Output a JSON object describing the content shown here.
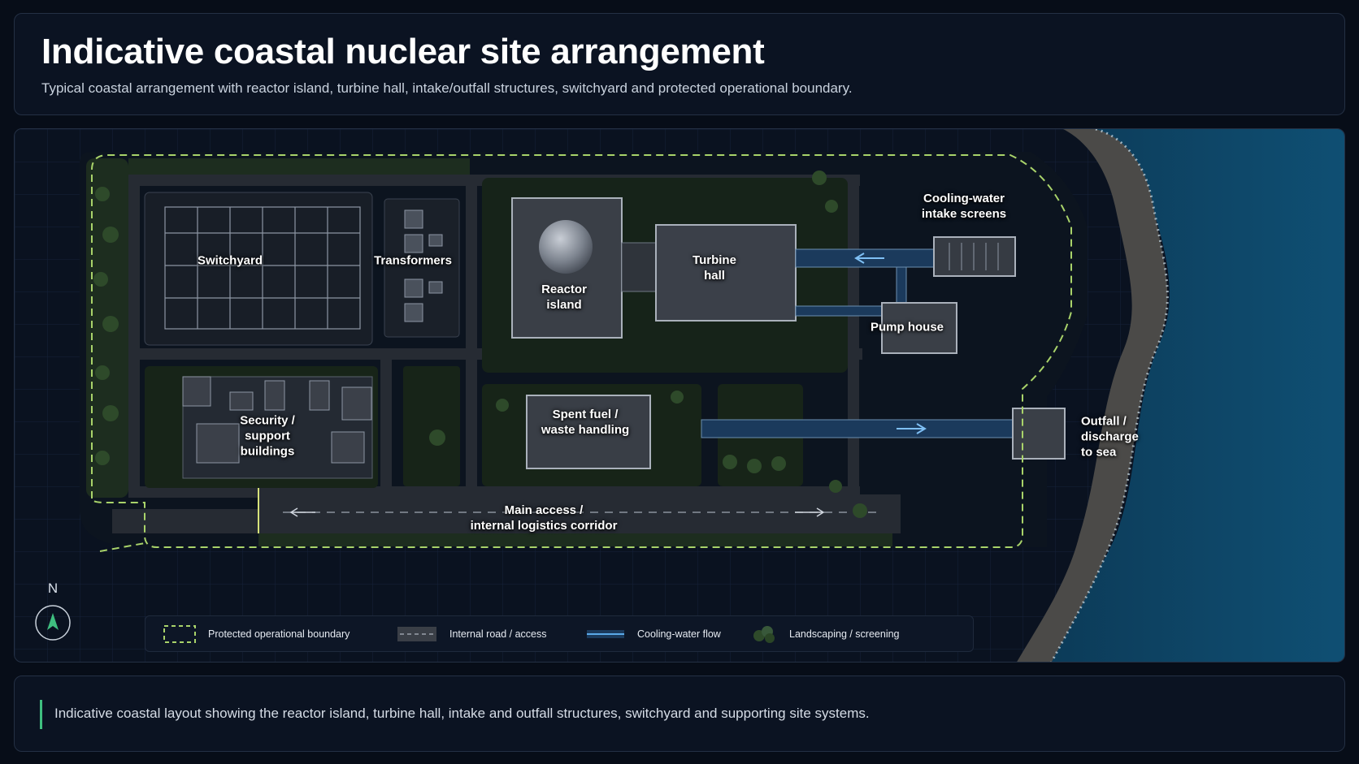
{
  "header": {
    "title": "Indicative coastal nuclear site arrangement",
    "subtitle": "Typical coastal arrangement with reactor island, turbine hall, intake/outfall structures, switchyard and protected operational boundary."
  },
  "map": {
    "labels": {
      "switchyard": "Switchyard",
      "transformers": "Transformers",
      "reactor_island": "Reactor\nisland",
      "turbine_hall": "Turbine\nhall",
      "intake_screens": "Cooling-water\nintake screens",
      "pump_house": "Pump house",
      "security_support": "Security /\nsupport\nbuildings",
      "spent_fuel": "Spent fuel /\nwaste handling",
      "outfall": "Outfall /\ndischarge\nto sea",
      "main_access": "Main access /\ninternal logistics corridor"
    },
    "compass": {
      "label": "N"
    },
    "colors": {
      "boundary": "#a9d36a",
      "water_flow": "#5aa9e8",
      "sea": "#0f4a6c",
      "landscaping": "#2e4a2a"
    }
  },
  "legend": {
    "items": [
      {
        "label": "Protected operational boundary",
        "icon": "dashed-boundary-swatch"
      },
      {
        "label": "Internal road / access",
        "icon": "road-swatch"
      },
      {
        "label": "Cooling-water flow",
        "icon": "water-flow-swatch"
      },
      {
        "label": "Landscaping / screening",
        "icon": "tree-cluster-icon"
      }
    ]
  },
  "footer": {
    "caption": "Indicative coastal layout showing the reactor island, turbine hall, intake and outfall structures, switchyard and supporting site systems."
  }
}
